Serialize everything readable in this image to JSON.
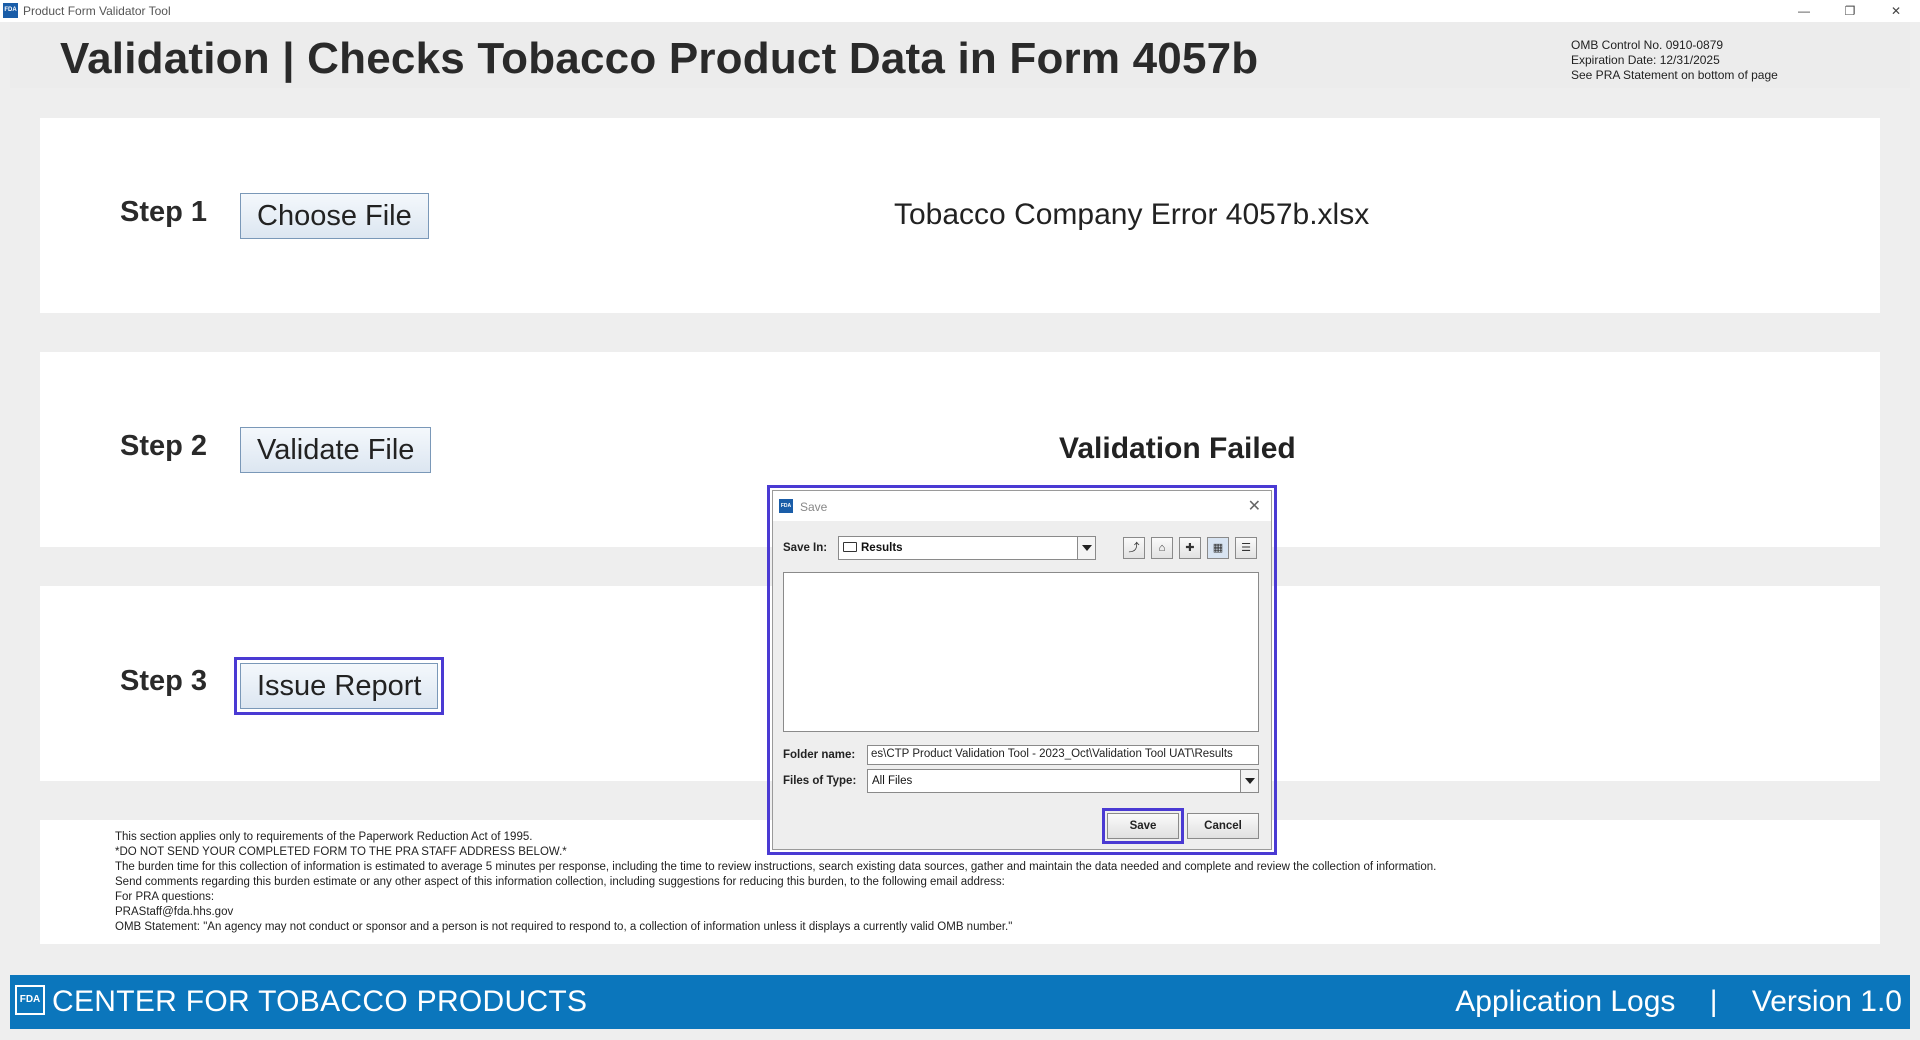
{
  "window": {
    "app_icon_text": "FDA",
    "title": "Product Form Validator Tool",
    "minimize_glyph": "—",
    "maximize_glyph": "❐",
    "close_glyph": "✕"
  },
  "header": {
    "title": "Validation | Checks Tobacco Product Data in Form 4057b",
    "omb_control": "OMB Control No. 0910-0879",
    "expiration": "Expiration Date: 12/31/2025",
    "pra_note": "See PRA Statement on bottom of page"
  },
  "steps": [
    {
      "label": "Step 1",
      "button": "Choose File",
      "value": "Tobacco Company Error 4057b.xlsx"
    },
    {
      "label": "Step 2",
      "button": "Validate File",
      "value": "Validation Failed"
    },
    {
      "label": "Step 3",
      "button": "Issue Report",
      "value": ""
    }
  ],
  "pra": {
    "lines": [
      "This section applies only to requirements of the Paperwork Reduction Act of 1995.",
      "*DO NOT SEND YOUR COMPLETED FORM TO THE PRA STAFF ADDRESS BELOW.*",
      "The burden time for this collection of information is estimated to average 5 minutes per response, including the time to review instructions, search existing data sources, gather and maintain the data needed and complete and review the collection of information.",
      "Send comments regarding this burden estimate or any other aspect of this information collection, including suggestions for reducing this burden, to the following email address:",
      "For PRA questions:",
      "PRAStaff@fda.hhs.gov",
      "OMB Statement: \"An agency may not conduct or sponsor and a person is not required to respond to, a collection of information unless it displays a currently valid OMB number.\""
    ]
  },
  "footer": {
    "logo_text": "FDA",
    "org": "CENTER FOR TOBACCO PRODUCTS",
    "logs_link": "Application Logs",
    "separator": "|",
    "version": "Version 1.0"
  },
  "dialog": {
    "icon_text": "FDA",
    "title": "Save",
    "close_glyph": "✕",
    "save_in_label": "Save In:",
    "save_in_value": "Results",
    "folder_name_label": "Folder name:",
    "folder_name_value": "es\\CTP Product Validation Tool - 2023_Oct\\Validation Tool UAT\\Results",
    "files_of_type_label": "Files of Type:",
    "files_of_type_value": "All Files",
    "save_button": "Save",
    "cancel_button": "Cancel",
    "tool_glyphs": [
      "⤴",
      "⌂",
      "✚",
      "▦",
      "☰"
    ]
  }
}
